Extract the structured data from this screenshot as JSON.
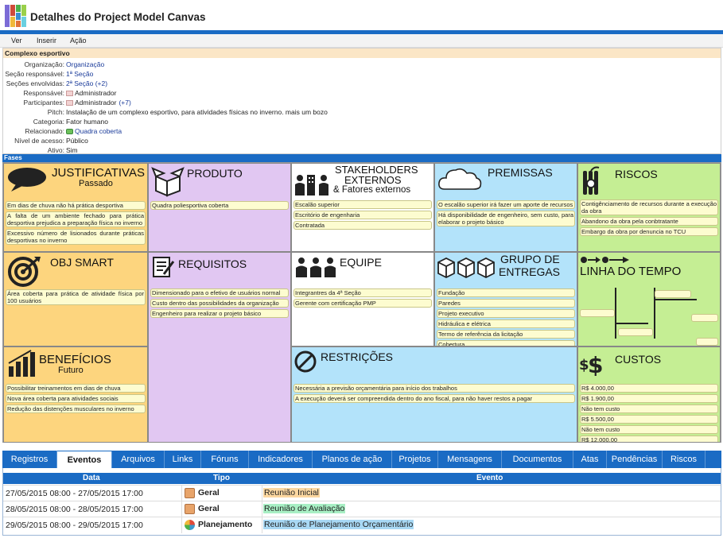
{
  "app": {
    "title": "Detalhes do Project Model Canvas"
  },
  "menu": [
    "Ver",
    "Inserir",
    "Ação"
  ],
  "project": {
    "name": "Complexo esportivo",
    "fields": [
      {
        "label": "Organização:",
        "value": "Organização",
        "link": true
      },
      {
        "label": "Seção responsável:",
        "value": "1ª Seção",
        "link": true
      },
      {
        "label": "Seções envolvidas:",
        "value": "2ª Seção (+2)",
        "link": true
      },
      {
        "label": "Responsável:",
        "value": "Administrador",
        "icon": true
      },
      {
        "label": "Participantes:",
        "value": "Administrador",
        "extra": "(+7)",
        "icon": true
      },
      {
        "label": "Pitch:",
        "value": "Instalação de um complexo esportivo, para atividades físicas no inverno. mais um bozo"
      },
      {
        "label": "Categoria:",
        "value": "Fator humano"
      },
      {
        "label": "Relacionado:",
        "value": "Quadra coberta",
        "link": true,
        "puzzle": true
      },
      {
        "label": "Nível de acesso:",
        "value": "Público"
      },
      {
        "label": "Ativo:",
        "value": "Sim"
      }
    ]
  },
  "fases_label": "Fases",
  "canvas": {
    "justificativas": {
      "title": "JUSTIFICATIVAS",
      "sub": "Passado",
      "items": [
        "Em dias de chuva não há prática desportiva",
        "A falta de um ambiente fechado para prática desportiva prejudica a preparação física no inverno",
        "Excessivo número de lisionados durante práticas desportivas no inverno"
      ]
    },
    "obj_smart": {
      "title": "OBJ SMART",
      "items": [
        "Área coberta para prática de atividade física por 100 usuários"
      ]
    },
    "beneficios": {
      "title": "BENEFÍCIOS",
      "sub": "Futuro",
      "items": [
        "Possibilitar treinamentos em dias de chuva",
        "Nova área coberta para atividades sociais",
        "Redução das distenções musculares no inverno"
      ]
    },
    "produto": {
      "title": "PRODUTO",
      "items": [
        "Quadra poliesportiva coberta"
      ]
    },
    "requisitos": {
      "title": "REQUISITOS",
      "items": [
        "Dimensionado para o efetivo de usuários normal",
        "Custo dentro das possibilidades da organização",
        "Engenheiro para realizar o projeto básico"
      ]
    },
    "stakeholders": {
      "title1": "STAKEHOLDERS",
      "title2": "EXTERNOS",
      "title3": "& Fatores externos",
      "items": [
        "Escalão superior",
        "Escritório de engenharia",
        "Contratada"
      ]
    },
    "equipe": {
      "title": "EQUIPE",
      "items": [
        "Integrantres da 4ª Seção",
        "Gerente com certificação PMP"
      ]
    },
    "premissas": {
      "title": "PREMISSAS",
      "items": [
        "O escalão superior irá fazer um aporte de recursos",
        "Há disponibilidade de engenheiro, sem custo, para elaborar o projeto básico"
      ]
    },
    "entregas": {
      "title1": "GRUPO DE",
      "title2": "ENTREGAS",
      "items": [
        "Fundação",
        "Paredes",
        "Projeto executivo",
        "Hidráulica e elétrica",
        "Termo de referência da licitação",
        "Cobertura"
      ]
    },
    "restricoes": {
      "title": "RESTRIÇÕES",
      "items": [
        "Necessária a previsão orçamentária para início dos trabalhos",
        "A execução deverá ser compreendida dentro do ano fiscal, para não haver restos a pagar"
      ]
    },
    "riscos": {
      "title": "RISCOS",
      "items": [
        "Contigênciamento de recursos durante a execução da obra",
        "Abandono da obra pela conbtratante",
        "Embargo da obra por denuncia no TCU"
      ]
    },
    "linha_tempo": {
      "title": "LINHA DO TEMPO"
    },
    "custos": {
      "title": "CUSTOS",
      "items": [
        "R$ 4.000,00",
        "R$ 1.900,00",
        "Não tem custo",
        "R$ 5.500,00",
        "Não tem custo",
        "R$ 12.000,00"
      ]
    }
  },
  "tabs": [
    "Registros",
    "Eventos",
    "Arquivos",
    "Links",
    "Fóruns",
    "Indicadores",
    "Planos de ação",
    "Projetos",
    "Mensagens",
    "Documentos",
    "Atas",
    "Pendências",
    "Riscos"
  ],
  "active_tab": "Eventos",
  "events": {
    "headers": {
      "data": "Data",
      "tipo": "Tipo",
      "evento": "Evento"
    },
    "rows": [
      {
        "data": "27/05/2015 08:00 - 27/05/2015 17:00",
        "tipo": "Geral",
        "evento": "Reunião Inicial",
        "color": "#fcd7a0"
      },
      {
        "data": "28/05/2015 08:00 - 28/05/2015 17:00",
        "tipo": "Geral",
        "evento": "Reunião de Avaliação",
        "color": "#a8efc4"
      },
      {
        "data": "29/05/2015 08:00 - 29/05/2015 17:00",
        "tipo": "Planejamento",
        "evento": "Reunião de Planejamento Orçamentário",
        "color": "#a8d8f4"
      }
    ]
  }
}
